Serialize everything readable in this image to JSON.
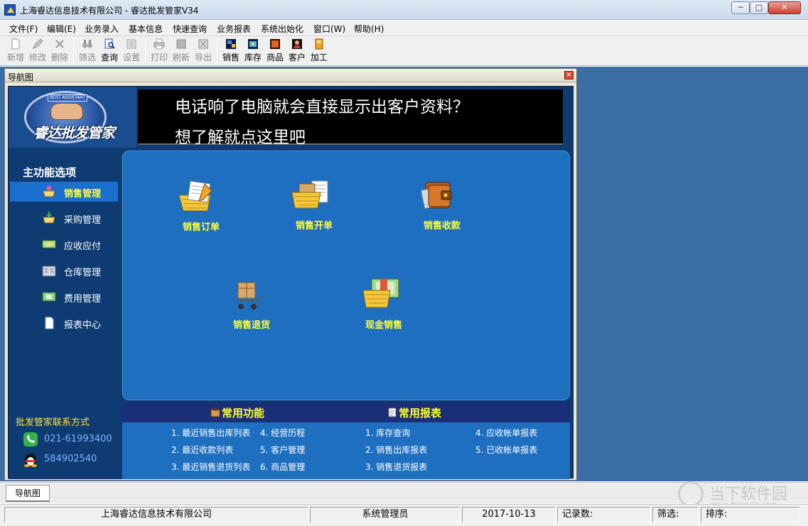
{
  "window": {
    "title": "上海睿达信息技术有限公司 - 睿达批发管家V34"
  },
  "menu": [
    "文件(F)",
    "编辑(E)",
    "业务录入",
    "基本信息",
    "快速查询",
    "业务报表",
    "系统出始化",
    "窗口(W)",
    "帮助(H)"
  ],
  "toolbar": {
    "items": [
      {
        "label": "新增",
        "icon": "new-doc-icon",
        "enabled": false
      },
      {
        "label": "修改",
        "icon": "edit-icon",
        "enabled": false
      },
      {
        "label": "删除",
        "icon": "delete-icon",
        "enabled": false
      },
      {
        "label": "筛选",
        "icon": "binoculars-icon",
        "enabled": false
      },
      {
        "label": "查询",
        "icon": "query-icon",
        "enabled": true
      },
      {
        "label": "设置",
        "icon": "settings-icon",
        "enabled": false
      },
      {
        "label": "打印",
        "icon": "print-icon",
        "enabled": false
      },
      {
        "label": "刷新",
        "icon": "refresh-icon",
        "enabled": false
      },
      {
        "label": "导出",
        "icon": "export-icon",
        "enabled": false
      },
      {
        "label": "销售",
        "icon": "sales-icon",
        "enabled": true
      },
      {
        "label": "库存",
        "icon": "inventory-icon",
        "enabled": true
      },
      {
        "label": "商品",
        "icon": "goods-icon",
        "enabled": true
      },
      {
        "label": "客户",
        "icon": "customer-icon",
        "enabled": true
      },
      {
        "label": "加工",
        "icon": "process-icon",
        "enabled": true
      }
    ]
  },
  "nav_window": {
    "title": "导航图",
    "logo_ribbon": "BEST ASSISTANT",
    "logo_text": "睿达批发管家",
    "banner": {
      "line1": "电话响了电脑就会直接显示出客户资料？",
      "line2": "想了解就点这里吧"
    },
    "sidebar": {
      "heading": "主功能选项",
      "items": [
        {
          "label": "销售管理",
          "icon": "sales-basket-icon",
          "active": true
        },
        {
          "label": "采购管理",
          "icon": "purchase-basket-icon",
          "active": false
        },
        {
          "label": "应收应付",
          "icon": "money-icon",
          "active": false
        },
        {
          "label": "仓库管理",
          "icon": "warehouse-icon",
          "active": false
        },
        {
          "label": "费用管理",
          "icon": "expense-icon",
          "active": false
        },
        {
          "label": "报表中心",
          "icon": "report-icon",
          "active": false
        }
      ],
      "contact_heading": "批发管家联系方式",
      "phone": "021-61993400",
      "qq": "584902540"
    },
    "functions": [
      {
        "label": "销售订单",
        "icon": "sales-order-icon"
      },
      {
        "label": "销售开单",
        "icon": "sales-invoice-icon"
      },
      {
        "label": "销售收款",
        "icon": "wallet-icon"
      },
      {
        "label": "销售退货",
        "icon": "return-cart-icon"
      },
      {
        "label": "现金销售",
        "icon": "cash-sale-icon"
      }
    ],
    "common": {
      "functions_title": "常用功能",
      "reports_title": "常用报表",
      "function_links": [
        "1. 最近销售出库列表",
        "2. 最近收款列表",
        "3. 最近销售退货列表",
        "4. 经营历程",
        "5. 客户管理",
        "6. 商品管理"
      ],
      "report_links": [
        "1. 库存查询",
        "2. 销售出库报表",
        "3. 销售退货报表",
        "4. 应收帐单报表",
        "5. 已收帐单报表"
      ]
    }
  },
  "tabs": [
    "导航图"
  ],
  "watermark": {
    "main": "当下软件园",
    "sub": "www.downxia.com"
  },
  "status": {
    "company": "上海睿达信息技术有限公司",
    "user": "系统管理员",
    "date": "2017-10-13",
    "records_label": "记录数:",
    "filter_label": "筛选:",
    "sort_label": "排序:"
  }
}
